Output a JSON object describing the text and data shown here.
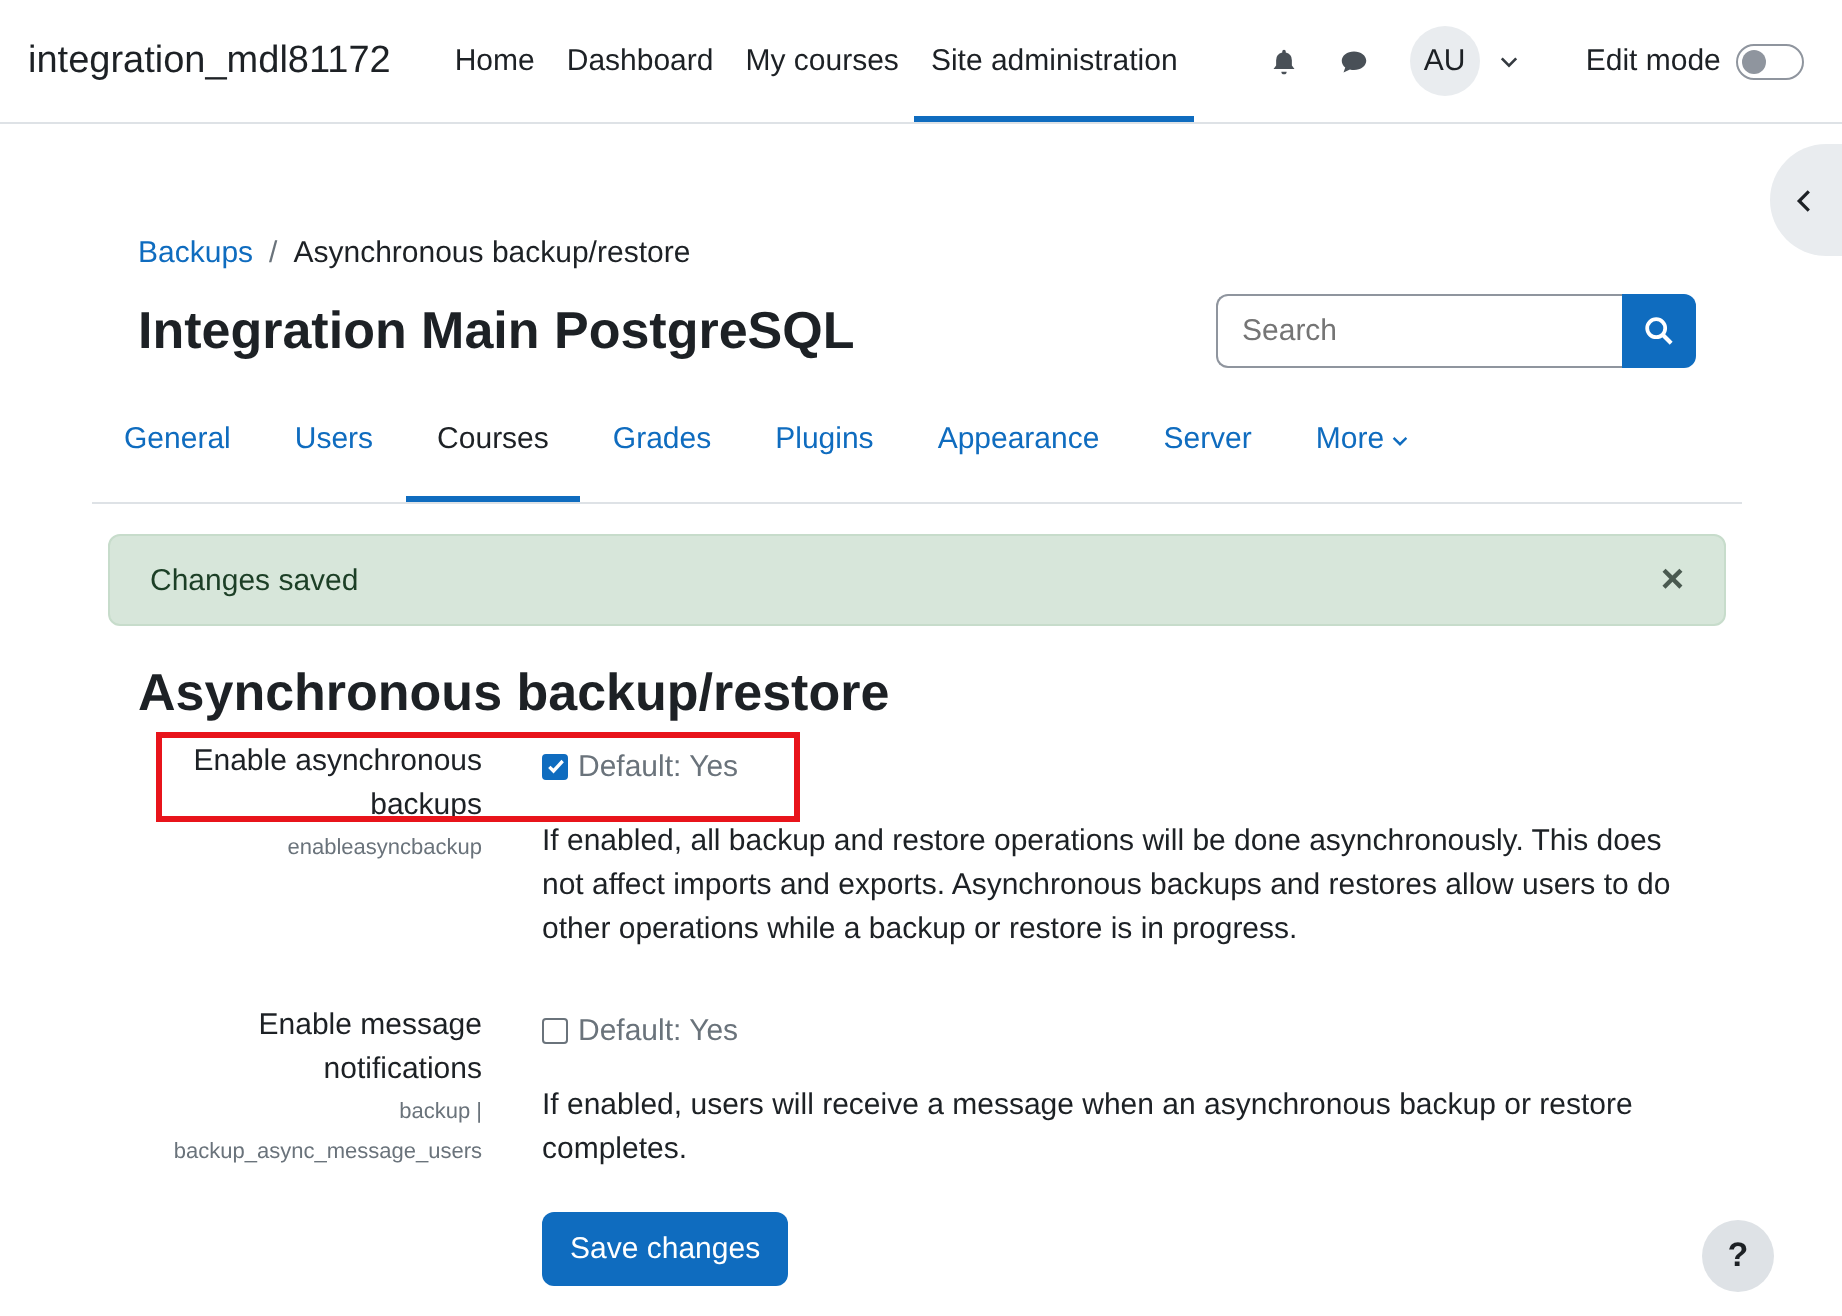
{
  "navbar": {
    "site_name": "integration_mdl81172",
    "items": [
      {
        "label": "Home",
        "selected": false
      },
      {
        "label": "Dashboard",
        "selected": false
      },
      {
        "label": "My courses",
        "selected": false
      },
      {
        "label": "Site administration",
        "selected": true
      }
    ],
    "avatar": "AU",
    "edit_mode": {
      "label": "Edit mode",
      "on": false
    }
  },
  "breadcrumb_separator": "/",
  "breadcrumb": [
    {
      "label": "Backups",
      "kind": "link"
    },
    {
      "label": "Asynchronous backup/restore",
      "kind": "current"
    }
  ],
  "page_title": "Integration Main PostgreSQL",
  "search": {
    "placeholder": "Search"
  },
  "tabs": [
    {
      "label": "General",
      "selected": false
    },
    {
      "label": "Users",
      "selected": false
    },
    {
      "label": "Courses",
      "selected": true
    },
    {
      "label": "Grades",
      "selected": false
    },
    {
      "label": "Plugins",
      "selected": false
    },
    {
      "label": "Appearance",
      "selected": false
    },
    {
      "label": "Server",
      "selected": false
    },
    {
      "label": "More",
      "selected": false
    }
  ],
  "alert": {
    "message": "Changes saved",
    "close": "×"
  },
  "section_title": "Asynchronous backup/restore",
  "settings": [
    {
      "label": "Enable asynchronous backups",
      "names": [
        "enableasyncbackup"
      ],
      "checked": true,
      "default": "Default: Yes",
      "highlighted": true,
      "description": "If enabled, all backup and restore operations will be done asynchronously. This does not affect imports and exports. Asynchronous backups and restores allow users to do other operations while a backup or restore is in progress."
    },
    {
      "label": "Enable message notifications",
      "names": [
        "backup |",
        "backup_async_message_users"
      ],
      "checked": false,
      "default": "Default: Yes",
      "highlighted": false,
      "description": "If enabled, users will receive a message when an asynchronous backup or restore completes."
    }
  ],
  "save_button": "Save changes",
  "help_button": "?"
}
